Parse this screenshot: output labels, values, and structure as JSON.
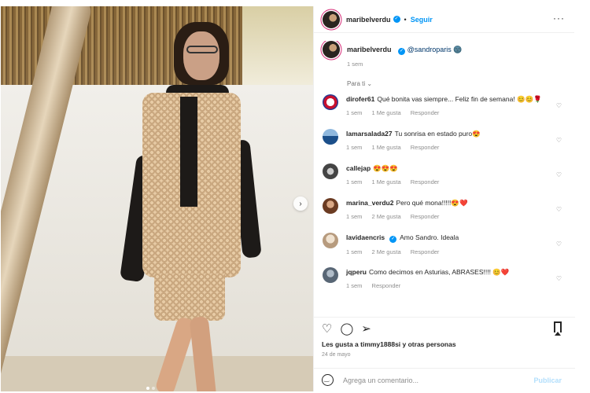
{
  "post": {
    "username": "maribelverdu",
    "follow": "Seguir",
    "caption_mention": "@sandroparis",
    "caption_emoji": "🌚",
    "caption_time": "1 sem",
    "sort_label": "Para ti",
    "likes_text": "Les gusta a timmy1888si y otras personas",
    "date": "24 de mayo",
    "comment_placeholder": "Agrega un comentario...",
    "publish": "Publicar"
  },
  "comments": [
    {
      "user": "dirofer61",
      "text": "Qué bonita vas siempre... Feliz fin de semana! 😊😊🌹",
      "time": "1 sem",
      "likes": "1 Me gusta",
      "reply": "Responder",
      "avatar_color": "#c8102e"
    },
    {
      "user": "lamarsalada27",
      "text": "Tu sonrisa en estado puro😍",
      "time": "1 sem",
      "likes": "1 Me gusta",
      "reply": "Responder",
      "avatar_color": "#3a6ea5"
    },
    {
      "user": "callejap",
      "text": "😍😍😍",
      "time": "1 sem",
      "likes": "1 Me gusta",
      "reply": "Responder",
      "avatar_color": "#555555"
    },
    {
      "user": "marina_verdu2",
      "text": "Pero qué mona!!!!!😍❤️",
      "time": "1 sem",
      "likes": "2 Me gusta",
      "reply": "Responder",
      "avatar_color": "#a0522d"
    },
    {
      "user": "lavidaencris",
      "text": "Amo Sandro. Ideala",
      "time": "1 sem",
      "likes": "2 Me gusta",
      "reply": "Responder",
      "avatar_color": "#d8c3a5",
      "verified": true
    },
    {
      "user": "jqperu",
      "text": "Como decimos en Asturias, ABRASES!!!! 😊❤️",
      "time": "1 sem",
      "likes": "",
      "reply": "Responder",
      "avatar_color": "#7a8899"
    }
  ]
}
